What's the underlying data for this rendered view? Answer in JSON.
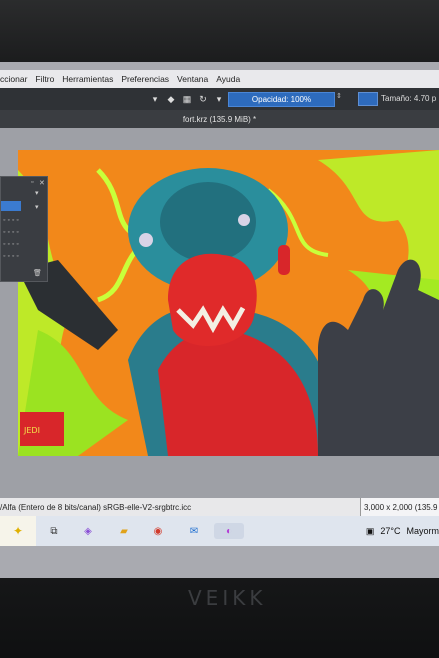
{
  "menubar": {
    "items": [
      "ccionar",
      "Filtro",
      "Herramientas",
      "Preferencias",
      "Ventana",
      "Ayuda"
    ]
  },
  "toolbar": {
    "opacity_label": "Opacidad: 100%",
    "size_label": "Tamaño: 4.70 p"
  },
  "document": {
    "title": "fort.krz (135.9 MiB) *"
  },
  "statusbar": {
    "color_info": "/Alfa (Entero de 8 bits/canal)  sRGB-elle-V2-srgbtrc.icc",
    "dimensions": "3,000 x 2,000 (135.9"
  },
  "taskbar": {
    "temperature": "27°C",
    "weather_text": "Mayorm"
  },
  "monitor": {
    "brand": "VEIKK"
  },
  "colors": {
    "accent_blue": "#2d6bbd",
    "art_orange": "#f08a16",
    "art_lime": "#b8f42a",
    "art_teal": "#2a8e9c",
    "art_red": "#e02a2a"
  }
}
